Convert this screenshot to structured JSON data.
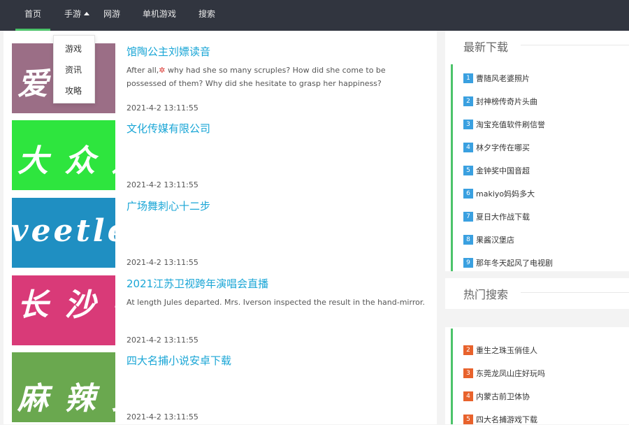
{
  "nav": {
    "items": [
      {
        "label": "首页"
      },
      {
        "label": "手游"
      },
      {
        "label": "网游"
      },
      {
        "label": "单机游戏"
      },
      {
        "label": "搜索"
      }
    ],
    "dropdown": [
      "游戏",
      "资讯",
      "攻略"
    ]
  },
  "posts": [
    {
      "title": "馆陶公主刘嫖读音",
      "desc_a": "After all,",
      "desc_b": " why had she so many scruples? How did she come to be possessed of them? Why did she hesitate to grasp her happiness?",
      "date": "2021-4-2 13:11:55",
      "thumb_text": "爱 么 傍",
      "thumb_color": "#9b6e86"
    },
    {
      "title": "文化传媒有限公司",
      "desc": "",
      "date": "2021-4-2 13:11:55",
      "thumb_text": "大 众 速",
      "thumb_color": "#2ee53e"
    },
    {
      "title": "广场舞刺心十二步",
      "desc": "",
      "date": "2021-4-2 13:11:55",
      "thumb_text": "veetle",
      "thumb_color": "#1f8fc2"
    },
    {
      "title": "2021江苏卫视跨年演唱会直播",
      "desc": "At length Jules departed. Mrs. Iverson inspected the result in the hand-mirror.",
      "date": "2021-4-2 13:11:55",
      "thumb_text": "长 沙 银",
      "thumb_color": "#d93a78"
    },
    {
      "title": "四大名捕小说安卓下载",
      "desc": "",
      "date": "2021-4-2 13:11:55",
      "thumb_text": "麻 辣 女",
      "thumb_color": "#6aa84f"
    }
  ],
  "latest": {
    "heading": "最新下载",
    "items": [
      {
        "n": "1",
        "label": "曹随风老婆照片"
      },
      {
        "n": "2",
        "label": "封神榜传奇片头曲"
      },
      {
        "n": "3",
        "label": "淘宝充值软件刷信誉"
      },
      {
        "n": "4",
        "label": "林夕字传在哪买"
      },
      {
        "n": "5",
        "label": "金钟奖中国音超"
      },
      {
        "n": "6",
        "label": "makiyo妈妈多大"
      },
      {
        "n": "7",
        "label": "夏日大作战下载"
      },
      {
        "n": "8",
        "label": "果酱汉堡店"
      },
      {
        "n": "9",
        "label": "那年冬天起风了电视剧"
      }
    ],
    "badge_color": "#3aa0e0"
  },
  "hot": {
    "heading": "热门搜索",
    "items": [
      {
        "n": "2",
        "label": "重生之珠玉俏佳人"
      },
      {
        "n": "3",
        "label": "东莞龙凤山庄好玩吗"
      },
      {
        "n": "4",
        "label": "内蒙古前卫体协"
      },
      {
        "n": "5",
        "label": "四大名捕游戏下载"
      }
    ],
    "badge_color": "#e8622c"
  },
  "colors": {
    "accent": "#4cc36a",
    "link": "#1aa6d6",
    "topbar": "#31353f"
  }
}
